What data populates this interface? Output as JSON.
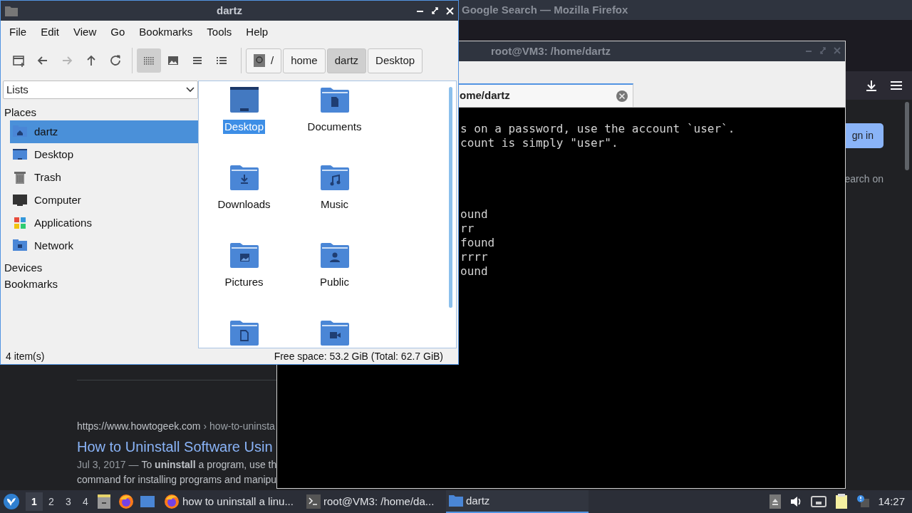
{
  "firefox": {
    "title": "Google Search — Mozilla Firefox",
    "result": {
      "url": "https://www.howtogeek.com",
      "path": "› how-to-uninsta",
      "title": "How to Uninstall Software Usin",
      "date": "Jul 3, 2017 —",
      "snippet": "To **uninstall** a program, use th",
      "snippet_line2": "command for installing programs and manipu"
    },
    "sign_in": "gn in",
    "side_text": "earch on"
  },
  "terminal": {
    "title": "root@VM3: /home/dartz",
    "tab_label": "ome/dartz",
    "blocks": [
      [
        "s on a password, use the account `user`.",
        "count is simply \"user\"."
      ],
      [
        "ound",
        "rr",
        "found",
        "rrrr",
        "ound"
      ]
    ]
  },
  "file_manager": {
    "title": "dartz",
    "menus": [
      "File",
      "Edit",
      "View",
      "Go",
      "Bookmarks",
      "Tools",
      "Help"
    ],
    "nav_buttons": [
      {
        "kind": "new-tab",
        "disabled": false
      },
      {
        "kind": "back",
        "disabled": false
      },
      {
        "kind": "forward",
        "disabled": true
      },
      {
        "kind": "up",
        "disabled": false
      },
      {
        "kind": "reload",
        "disabled": false
      }
    ],
    "view_buttons": [
      {
        "kind": "icons",
        "selected": true
      },
      {
        "kind": "thumbnails",
        "selected": false
      },
      {
        "kind": "compact",
        "selected": false
      },
      {
        "kind": "details",
        "selected": false
      }
    ],
    "path": [
      {
        "label": "/",
        "kind": "root",
        "selected": false
      },
      {
        "label": "home",
        "kind": "dir",
        "selected": false
      },
      {
        "label": "dartz",
        "kind": "dir",
        "selected": true
      },
      {
        "label": "Desktop",
        "kind": "dir",
        "selected": false
      }
    ],
    "side_dropdown": "Lists",
    "places_heading": "Places",
    "places": [
      {
        "label": "dartz",
        "kind": "home",
        "selected": true
      },
      {
        "label": "Desktop",
        "kind": "desktop",
        "selected": false
      },
      {
        "label": "Trash",
        "kind": "trash",
        "selected": false
      },
      {
        "label": "Computer",
        "kind": "computer",
        "selected": false
      },
      {
        "label": "Applications",
        "kind": "apps",
        "selected": false
      },
      {
        "label": "Network",
        "kind": "network",
        "selected": false
      }
    ],
    "devices_heading": "Devices",
    "bookmarks_heading": "Bookmarks",
    "files": [
      {
        "name": "Desktop",
        "kind": "desktop",
        "selected": true
      },
      {
        "name": "Documents",
        "kind": "documents",
        "selected": false
      },
      {
        "name": "Downloads",
        "kind": "downloads",
        "selected": false
      },
      {
        "name": "Music",
        "kind": "music",
        "selected": false
      },
      {
        "name": "Pictures",
        "kind": "pictures",
        "selected": false
      },
      {
        "name": "Public",
        "kind": "public",
        "selected": false
      },
      {
        "kind": "templates",
        "selected": false
      },
      {
        "kind": "videos",
        "selected": false
      }
    ],
    "status_left": "4 item(s)",
    "status_right": "Free space: 53.2 GiB (Total: 62.7 GiB)"
  },
  "taskbar": {
    "workspaces": [
      {
        "label": "1",
        "selected": true
      },
      {
        "label": "2",
        "selected": false
      },
      {
        "label": "3",
        "selected": false
      },
      {
        "label": "4",
        "selected": false
      }
    ],
    "tasks": [
      {
        "label": "how to uninstall a linu...",
        "kind": "firefox",
        "selected": false
      },
      {
        "label": "root@VM3: /home/da...",
        "kind": "terminal",
        "selected": false
      },
      {
        "label": "dartz",
        "kind": "folder",
        "selected": true
      }
    ],
    "clock": "14:27"
  }
}
